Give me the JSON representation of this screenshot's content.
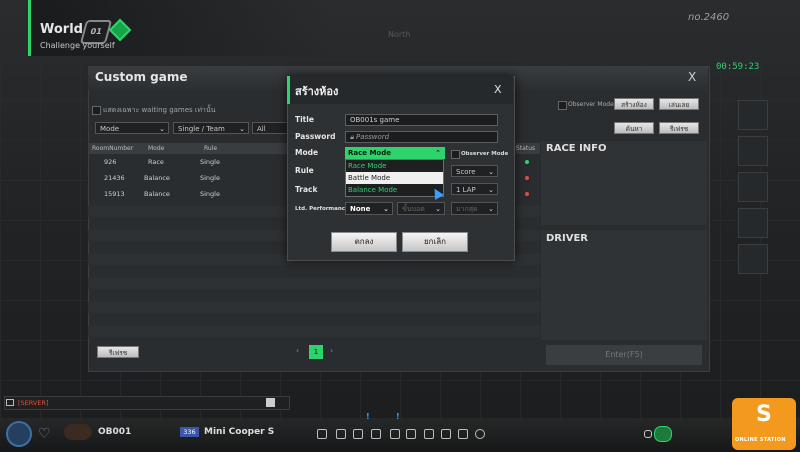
{
  "world": {
    "title": "World",
    "subtitle": "Challenge yourself",
    "badge": "01"
  },
  "top": {
    "number": "no.2460",
    "timer": "00:59:23",
    "north": "North"
  },
  "custom_game": {
    "title": "Custom game",
    "close": "X",
    "filter_label": "แสดงเฉพาะ waiting games เท่านั้น",
    "filters": {
      "mode": "Mode",
      "team": "Single / Team",
      "all": "All"
    },
    "observer_label": "Observer Mode",
    "create_room_btn": "สร้างห้อง",
    "quick_join_btn": "เล่นเลย",
    "search_btn": "ค้นหา",
    "refresh_top_btn": "รีเฟรช",
    "columns": [
      "RoomNumber",
      "Mode",
      "Rule",
      "Status"
    ],
    "rows": [
      {
        "room": "926",
        "mode": "Race",
        "rule": "Single"
      },
      {
        "room": "21436",
        "mode": "Balance",
        "rule": "Single"
      },
      {
        "room": "15913",
        "mode": "Balance",
        "rule": "Single"
      }
    ],
    "race_info": "RACE INFO",
    "driver": "DRIVER",
    "enter": "Enter(F5)",
    "refresh_btn": "รีเฟรช",
    "page": "1"
  },
  "create_room": {
    "title": "สร้างห้อง",
    "close": "X",
    "title_label": "Title",
    "title_value": "OB001s game",
    "password_label": "Password",
    "password_placeholder": "Password",
    "mode_label": "Mode",
    "mode_selected": "Race Mode",
    "mode_options": [
      "Race Mode",
      "Battle Mode",
      "Balance Mode"
    ],
    "observer_label": "Observer Mode",
    "rule_label": "Rule",
    "rule_value": "Score",
    "track_label": "Track",
    "track_value": "1 LAP",
    "ltd_label": "Ltd. Performance",
    "ltd_value": "None",
    "ltd_opt2": "ขั้นบอด",
    "ltd_opt3": "มากสุด",
    "ok_btn": "ตกลง",
    "cancel_btn": "ยกเลิก"
  },
  "bottom": {
    "server": "[SERVER]",
    "player": "OB001",
    "level": "336",
    "car": "Mini Cooper S",
    "logo_letter": "S",
    "logo_text": "ONLINE STATION"
  },
  "colors": {
    "accent": "#2fd36b",
    "danger": "#e0503a",
    "logo": "#f39a1e"
  }
}
